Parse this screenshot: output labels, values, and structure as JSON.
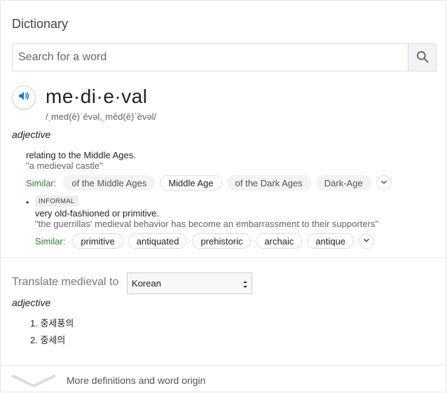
{
  "card": {
    "title": "Dictionary"
  },
  "search": {
    "placeholder": "Search for a word",
    "value": ""
  },
  "entry": {
    "headword": "me·di·e·val",
    "phonetic": "/ˌmed(ē)ˈēvəl,ˌmēd(ē)ˈēvəl/",
    "part_of_speech": "adjective",
    "senses": [
      {
        "definition": "relating to the Middle Ages.",
        "example": "\"a medieval castle\"",
        "similar_label": "Similar:",
        "similar": [
          "of the Middle Ages",
          "Middle Age",
          "of the Dark Ages",
          "Dark-Age"
        ]
      },
      {
        "bullet": "•",
        "register": "INFORMAL",
        "definition": "very old-fashioned or primitive.",
        "example": "\"the guerrillas' medieval behavior has become an embarrassment to their supporters\"",
        "similar_label": "Similar:",
        "similar": [
          "primitive",
          "antiquated",
          "prehistoric",
          "archaic",
          "antique"
        ]
      }
    ]
  },
  "translate": {
    "label": "Translate medieval to",
    "language": "Korean",
    "part_of_speech": "adjective",
    "items": [
      "1. 중세풍의",
      "2. 중세의"
    ]
  },
  "footer": {
    "more_label": "More definitions and word origin"
  },
  "colors": {
    "similar_label": "#2f7d33",
    "speaker_icon": "#1a73e8"
  },
  "icons": {
    "search": "search-icon",
    "speaker": "speaker-icon",
    "expand": "chevron-down-icon"
  }
}
